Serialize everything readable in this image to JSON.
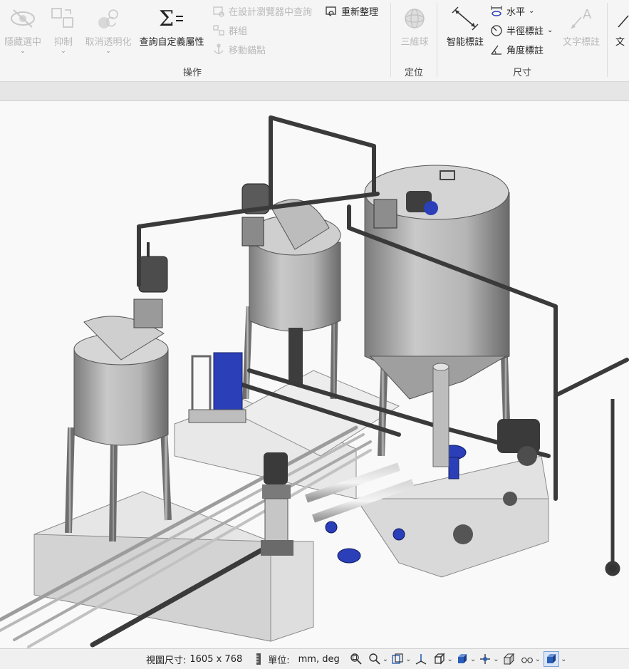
{
  "ribbon": {
    "buttons": {
      "hide": "隱藏選中",
      "suppress": "抑制",
      "cancel_transparent": "取消透明化",
      "query_custom": "查詢自定義屬性",
      "trackball": "三維球",
      "smart_dimension": "智能標註",
      "text_annotation": "文字標註",
      "cut_label": "文"
    },
    "small": {
      "query_in_browser": "在設計瀏覽器中查詢",
      "group": "群組",
      "move_anchor": "移動錨點",
      "reorganize": "重新整理",
      "horizontal": "水平",
      "radius_dimension": "半徑標註",
      "angle_dimension": "角度標註"
    },
    "groups": {
      "operation": "操作",
      "position": "定位",
      "dimension": "尺寸"
    }
  },
  "status": {
    "view_size_label": "視圖尺寸:",
    "view_size_value": "1605 x  768",
    "units_label": "單位:",
    "units_value": "mm, deg"
  },
  "colors": {
    "accent_blue": "#2a3fb8",
    "tank_grey": "#b0b0b0",
    "pipe_dark": "#3a3a3a",
    "ribbon_bg": "#f5f5f5"
  },
  "icons": [
    "eye-hide-icon",
    "cubes-icon",
    "spheres-icon",
    "sigma-icon",
    "browser-query-icon",
    "group-icon",
    "anchor-move-icon",
    "refresh-icon",
    "trackball-icon",
    "smart-dimension-icon",
    "horizontal-dim-icon",
    "radius-dim-icon",
    "angle-dim-icon",
    "text-annotation-icon",
    "zoom-fit-icon",
    "zoom-icon",
    "view-orient-icon",
    "axis-icon",
    "box-icon",
    "shaded-box-icon",
    "walk-icon",
    "cube-gear-icon",
    "glasses-icon",
    "render-mode-icon"
  ]
}
